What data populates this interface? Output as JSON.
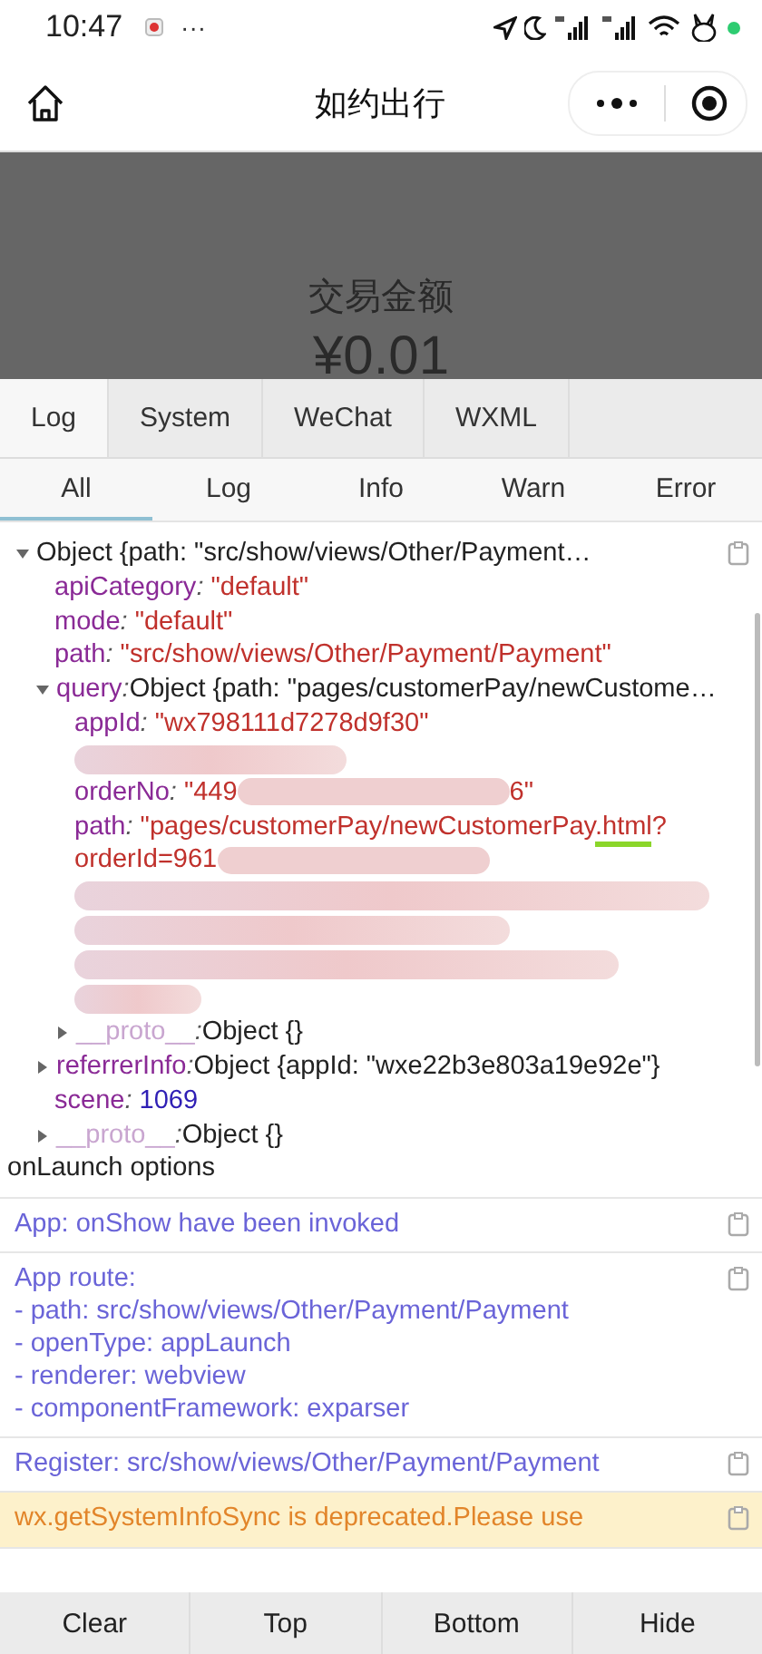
{
  "status_bar": {
    "time": "10:47",
    "more": "···"
  },
  "nav": {
    "title": "如约出行"
  },
  "page": {
    "heading": "交易金额",
    "amount": "¥0.01"
  },
  "tabs": [
    {
      "label": "Log",
      "selected": true
    },
    {
      "label": "System",
      "selected": false
    },
    {
      "label": "WeChat",
      "selected": false
    },
    {
      "label": "WXML",
      "selected": false
    }
  ],
  "filters": [
    {
      "label": "All",
      "selected": true
    },
    {
      "label": "Log",
      "selected": false
    },
    {
      "label": "Info",
      "selected": false
    },
    {
      "label": "Warn",
      "selected": false
    },
    {
      "label": "Error",
      "selected": false
    }
  ],
  "entries": [
    {
      "kind": "tree",
      "caption": "onLaunch options",
      "root": {
        "kind": "object",
        "expanded": true,
        "summary": "Object {path: \"src/show/views/Other/Payment…",
        "children": [
          {
            "kind": "prop",
            "key": "apiCategory",
            "sep": ":",
            "value": "\"default\"",
            "numeric": false
          },
          {
            "kind": "prop",
            "key": "mode",
            "sep": ":",
            "value": "\"default\"",
            "numeric": false
          },
          {
            "kind": "prop",
            "key": "path",
            "sep": ":",
            "value": "\"src/show/views/Other/Payment/Payment\"",
            "numeric": false
          },
          {
            "kind": "object",
            "key": "query",
            "sep": ":",
            "expanded": true,
            "proto": false,
            "summary": "Object {path: \"pages/customerPay/newCustome…",
            "children": [
              {
                "kind": "prop",
                "key": "appId",
                "sep": ":",
                "value": "\"wx798111d7278d9f30\"",
                "numeric": false
              },
              {
                "kind": "redacted"
              },
              {
                "kind": "prop",
                "key": "orderNo",
                "sep": ":",
                "numeric": false,
                "parts": [
                  {
                    "kind": "text",
                    "text": "\"449"
                  },
                  {
                    "kind": "redacted"
                  },
                  {
                    "kind": "text",
                    "text": "6\""
                  }
                ]
              },
              {
                "kind": "prop",
                "key": "path",
                "sep": ":",
                "numeric": false,
                "parts": [
                  {
                    "kind": "text",
                    "text": "\"pages/customerPay/newCustomerPay"
                  },
                  {
                    "kind": "text",
                    "text": ".html",
                    "marked": true
                  },
                  {
                    "kind": "text",
                    "text": "?"
                  },
                  {
                    "kind": "break"
                  },
                  {
                    "kind": "text",
                    "text": "orderId=961"
                  },
                  {
                    "kind": "redacted"
                  }
                ]
              },
              {
                "kind": "redacted"
              },
              {
                "kind": "redacted"
              },
              {
                "kind": "redacted"
              },
              {
                "kind": "redacted"
              },
              {
                "kind": "object",
                "key": "__proto__",
                "sep": ":",
                "expanded": false,
                "proto": true,
                "summary": "Object {}"
              }
            ]
          },
          {
            "kind": "object",
            "key": "referrerInfo",
            "sep": ":",
            "expanded": false,
            "proto": false,
            "summary": "Object {appId: \"wxe22b3e803a19e92e\"}"
          },
          {
            "kind": "prop",
            "key": "scene",
            "sep": ":",
            "value": "1069",
            "numeric": true
          },
          {
            "kind": "object",
            "key": "__proto__",
            "sep": ":",
            "expanded": false,
            "proto": true,
            "summary": "Object {}"
          }
        ]
      }
    },
    {
      "kind": "info",
      "lines": [
        "App: onShow have been invoked"
      ]
    },
    {
      "kind": "info",
      "lines": [
        "App route:",
        "- path: src/show/views/Other/Payment/Payment",
        "- openType: appLaunch",
        "- renderer: webview",
        "- componentFramework: exparser"
      ]
    },
    {
      "kind": "info",
      "lines": [
        "Register: src/show/views/Other/Payment/Payment"
      ]
    },
    {
      "kind": "warn",
      "lines": [
        "wx.getSystemInfoSync is deprecated.Please use"
      ]
    }
  ],
  "actions": [
    "Clear",
    "Top",
    "Bottom",
    "Hide"
  ]
}
